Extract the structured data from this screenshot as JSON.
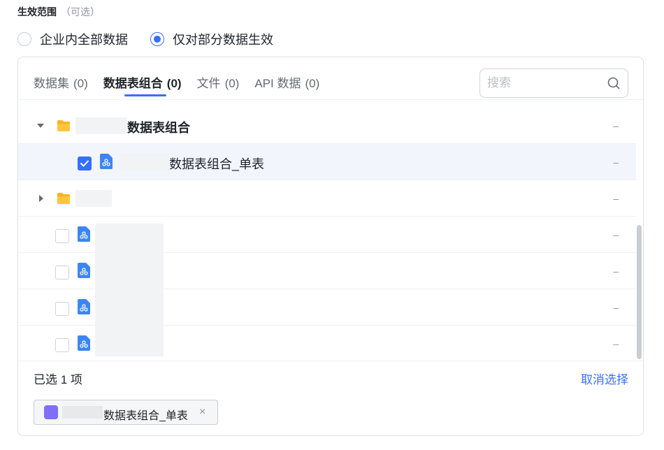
{
  "section": {
    "title": "生效范围",
    "optional": "（可选）"
  },
  "scope": {
    "options": [
      {
        "label": "企业内全部数据",
        "checked": false
      },
      {
        "label": "仅对部分数据生效",
        "checked": true
      }
    ]
  },
  "tabs": [
    {
      "label": "数据集",
      "count": "(0)",
      "active": false
    },
    {
      "label": "数据表组合",
      "count": "(0)",
      "active": true
    },
    {
      "label": "文件",
      "count": "(0)",
      "active": false
    },
    {
      "label": "API 数据",
      "count": "(0)",
      "active": false
    }
  ],
  "search": {
    "placeholder": "搜索"
  },
  "tree": {
    "group_label": "数据表组合",
    "table_label": "数据表组合_单表",
    "empty_marker": "–"
  },
  "footer": {
    "selected_count": "已选 1 项",
    "clear_label": "取消选择"
  },
  "chip": {
    "label": "数据表组合_单表",
    "close": "×"
  },
  "colors": {
    "accent": "#3370ff",
    "folder": "#ffb01f",
    "file_icon": "#3b86f7",
    "chip_icon": "#7f6ff7"
  }
}
